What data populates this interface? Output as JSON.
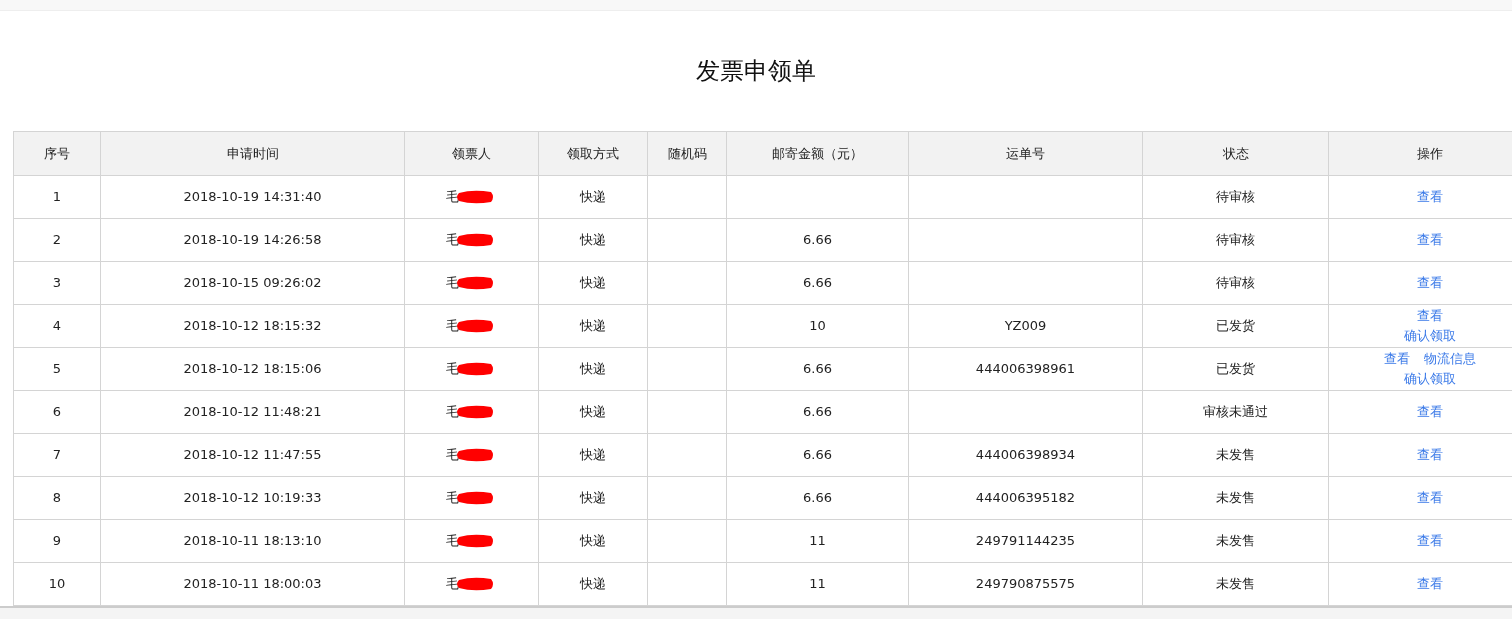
{
  "title": "发票申领单",
  "table": {
    "columns": [
      "序号",
      "申请时间",
      "领票人",
      "领取方式",
      "随机码",
      "邮寄金额（元）",
      "运单号",
      "状态",
      "操作"
    ],
    "rows": [
      {
        "index": "1",
        "time": "2018-10-19 14:31:40",
        "applicant": "毛",
        "redacted": true,
        "method": "快递",
        "code": "",
        "amount": "",
        "tracking": "",
        "status": "待审核",
        "actions": [
          [
            "查看"
          ]
        ]
      },
      {
        "index": "2",
        "time": "2018-10-19 14:26:58",
        "applicant": "毛",
        "redacted": true,
        "method": "快递",
        "code": "",
        "amount": "6.66",
        "tracking": "",
        "status": "待审核",
        "actions": [
          [
            "查看"
          ]
        ]
      },
      {
        "index": "3",
        "time": "2018-10-15 09:26:02",
        "applicant": "毛",
        "redacted": true,
        "method": "快递",
        "code": "",
        "amount": "6.66",
        "tracking": "",
        "status": "待审核",
        "actions": [
          [
            "查看"
          ]
        ]
      },
      {
        "index": "4",
        "time": "2018-10-12 18:15:32",
        "applicant": "毛",
        "redacted": true,
        "method": "快递",
        "code": "",
        "amount": "10",
        "tracking": "YZ009",
        "status": "已发货",
        "actions": [
          [
            "查看"
          ],
          [
            "确认领取"
          ]
        ]
      },
      {
        "index": "5",
        "time": "2018-10-12 18:15:06",
        "applicant": "毛",
        "redacted": true,
        "method": "快递",
        "code": "",
        "amount": "6.66",
        "tracking": "444006398961",
        "status": "已发货",
        "actions": [
          [
            "查看",
            "物流信息"
          ],
          [
            "确认领取"
          ]
        ]
      },
      {
        "index": "6",
        "time": "2018-10-12 11:48:21",
        "applicant": "毛",
        "redacted": true,
        "method": "快递",
        "code": "",
        "amount": "6.66",
        "tracking": "",
        "status": "审核未通过",
        "actions": [
          [
            "查看"
          ]
        ]
      },
      {
        "index": "7",
        "time": "2018-10-12 11:47:55",
        "applicant": "毛",
        "redacted": true,
        "method": "快递",
        "code": "",
        "amount": "6.66",
        "tracking": "444006398934",
        "status": "未发售",
        "actions": [
          [
            "查看"
          ]
        ]
      },
      {
        "index": "8",
        "time": "2018-10-12 10:19:33",
        "applicant": "毛",
        "redacted": true,
        "method": "快递",
        "code": "",
        "amount": "6.66",
        "tracking": "444006395182",
        "status": "未发售",
        "actions": [
          [
            "查看"
          ]
        ]
      },
      {
        "index": "9",
        "time": "2018-10-11 18:13:10",
        "applicant": "毛",
        "redacted": true,
        "method": "快递",
        "code": "",
        "amount": "11",
        "tracking": "249791144235",
        "status": "未发售",
        "actions": [
          [
            "查看"
          ]
        ]
      },
      {
        "index": "10",
        "time": "2018-10-11 18:00:03",
        "applicant": "毛",
        "redacted": true,
        "method": "快递",
        "code": "",
        "amount": "11",
        "tracking": "249790875575",
        "status": "未发售",
        "actions": [
          [
            "查看"
          ]
        ]
      }
    ]
  }
}
